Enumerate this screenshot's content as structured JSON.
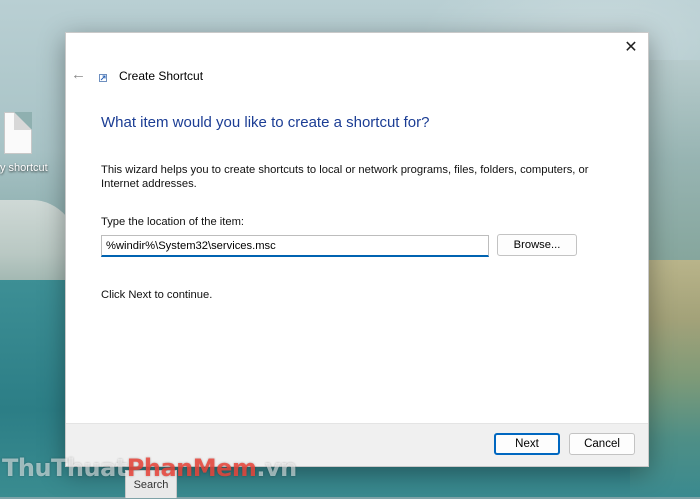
{
  "desktop": {
    "icon_label": "y shortcut",
    "taskbar_search_label": "Search"
  },
  "dialog": {
    "window_title": "Create Shortcut",
    "close_glyph": "✕",
    "back_glyph": "←",
    "headline": "What item would you like to create a shortcut for?",
    "description": "This wizard helps you to create shortcuts to local or network programs, files, folders, computers, or Internet addresses.",
    "location_label": "Type the location of the item:",
    "location_value": "%windir%\\System32\\services.msc",
    "browse_label": "Browse...",
    "hint": "Click Next to continue.",
    "next_label": "Next",
    "cancel_label": "Cancel"
  },
  "watermark": {
    "part1": "ThuThuat",
    "part2": "PhanMem",
    "part3": ".vn"
  },
  "colors": {
    "headline": "#1b3d94",
    "accent": "#0067c0",
    "footer_bg": "#f0f0f0"
  },
  "icons": [
    "close-icon",
    "back-arrow-icon",
    "shortcut-wizard-icon",
    "file-icon"
  ]
}
